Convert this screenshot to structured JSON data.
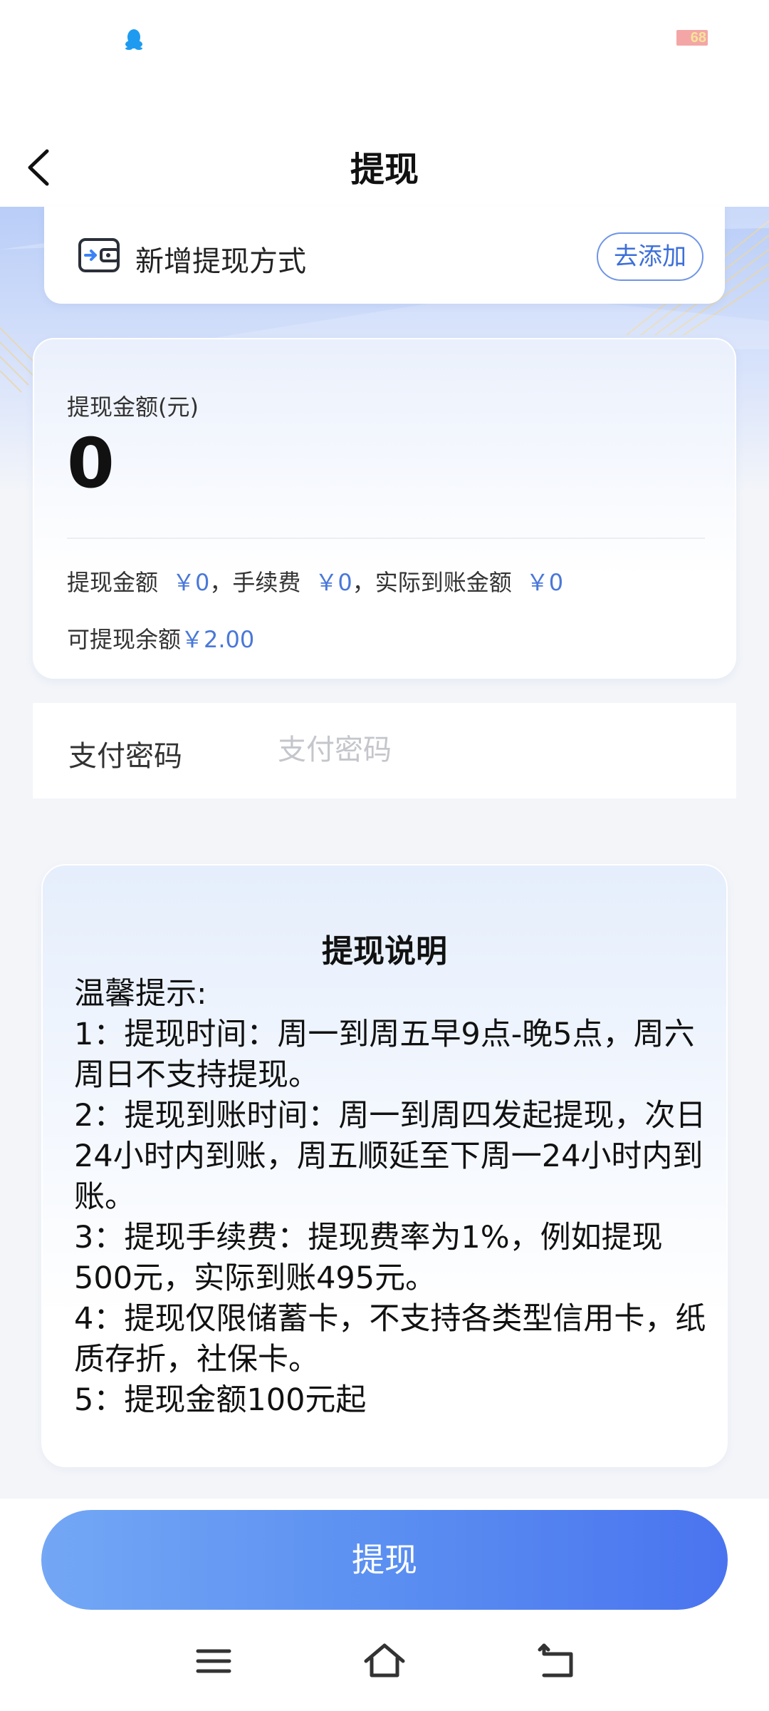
{
  "status_bar": {
    "notification_icon": "qq-penguin-icon",
    "battery_text": "68"
  },
  "nav": {
    "back_icon": "chevron-left-icon",
    "title": "提现"
  },
  "add_method": {
    "icon": "wallet-icon",
    "label": "新增提现方式",
    "button": "去添加"
  },
  "amount": {
    "label": "提现金额(元)",
    "value": "0",
    "fee_row": {
      "withdraw_label": "提现金额",
      "withdraw_value": "￥0",
      "fee_label": "，手续费",
      "fee_value": "￥0",
      "actual_label": "，实际到账金额",
      "actual_value": "￥0"
    },
    "balance_label": "可提现余额",
    "balance_value": "￥2.00"
  },
  "password": {
    "label": "支付密码",
    "placeholder": "支付密码"
  },
  "info": {
    "title": "提现说明",
    "lines": [
      "温馨提示:",
      "1：提现时间：周一到周五早9点-晚5点，周六周日不支持提现。",
      "2：提现到账时间：周一到周四发起提现，次日24小时内到账，周五顺延至下周一24小时内到账。",
      "3：提现手续费：提现费率为1%，例如提现500元，实际到账495元。",
      "4：提现仅限储蓄卡，不支持各类型信用卡，纸质存折，社保卡。",
      "5：提现金额100元起"
    ]
  },
  "submit_button": "提现",
  "system_nav": {
    "menu_icon": "menu-icon",
    "home_icon": "home-icon",
    "back_icon": "back-icon"
  },
  "colors": {
    "accent": "#4a78d8",
    "button_start": "#73a7f5",
    "button_end": "#4a74ef"
  }
}
